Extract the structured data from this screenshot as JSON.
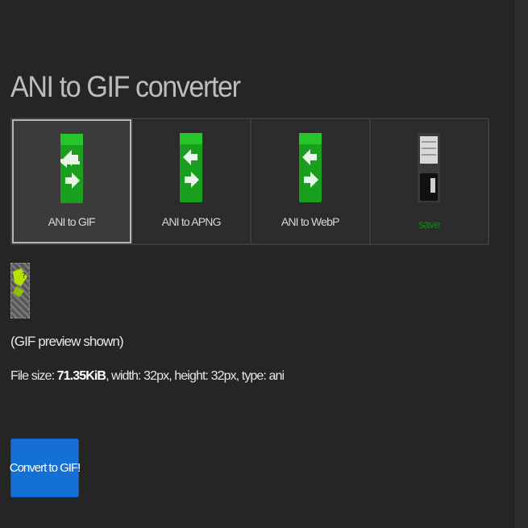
{
  "page": {
    "title": "ANI to GIF converter"
  },
  "tools": [
    {
      "label": "ANI to GIF",
      "icon": "convert-arrows-icon",
      "active": true
    },
    {
      "label": "ANI to APNG",
      "icon": "convert-arrows-icon",
      "active": false
    },
    {
      "label": "ANI to WebP",
      "icon": "convert-arrows-icon",
      "active": false
    },
    {
      "label": "save",
      "icon": "floppy-disk-icon",
      "active": false
    }
  ],
  "preview": {
    "note": "(GIF preview shown)"
  },
  "fileinfo": {
    "prefix": "File size: ",
    "size": "71.35KiB",
    "details": ", width: 32px, height: 32px, type: ani"
  },
  "actions": {
    "convert_label": "Convert to GIF!"
  },
  "colors": {
    "background": "#252525",
    "accent": "#1570d6",
    "icon_green": "#1a9e1e",
    "save_label": "#0f8a14"
  }
}
